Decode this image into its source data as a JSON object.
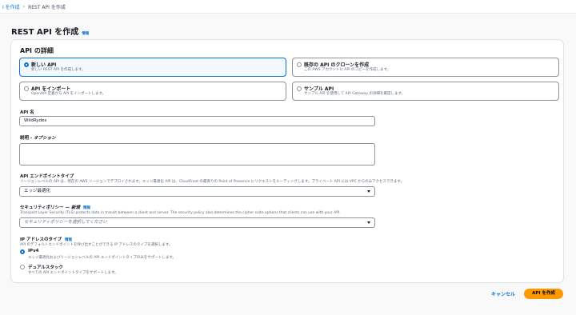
{
  "breadcrumb": {
    "parent": "I を作成",
    "separator": "›",
    "current": "REST API を作成"
  },
  "page": {
    "title": "REST API を作成",
    "info": "情報"
  },
  "details": {
    "title": "API の詳細",
    "options": [
      {
        "title": "新しい API",
        "desc": "新しい REST API を作成します。",
        "selected": true
      },
      {
        "title": "既存の API のクローンを作成",
        "desc": "この AWS アカウントに API のコピーを作成します。",
        "selected": false
      },
      {
        "title": "API をインポート",
        "desc": "OpenAPI 定義から API をインポートします。",
        "selected": false
      },
      {
        "title": "サンプル API",
        "desc": "サンプル API を使用して API Gateway の詳細を確認します。",
        "selected": false
      }
    ]
  },
  "api_name": {
    "label": "API 名",
    "value": "WildRydes"
  },
  "description": {
    "label": "説明 - ",
    "label_optional": "オプション",
    "value": ""
  },
  "endpoint": {
    "label": "API エンドポイントタイプ",
    "desc": "リージョンレベルの API は、現在の AWS リージョンでデプロイされます。エッジ最適化 API は、CloudFront の最寄りの Point of Presence にリクエストをルーティングします。プライベート API には VPC からのみアクセスできます。",
    "value": "エッジ最適化"
  },
  "security": {
    "label": "セキュリティポリシー — ",
    "label_new": "新規",
    "info": "情報",
    "desc": "Transport Layer Security (TLS) protects data in transit between a client and server. The security policy also determines the cipher suite options that clients can use with your API.",
    "placeholder": "セキュリティポリシーを選択してください"
  },
  "ip_type": {
    "label": "IP アドレスのタイプ",
    "info": "情報",
    "desc": "API のデフォルトエンドポイントを呼び出すことができる IP アドレスのタイプを選択します。",
    "options": [
      {
        "title": "IPv4",
        "desc": "エッジ最適化およびリージョンレベルの API エンドポイントタイプのみをサポートします。",
        "selected": true
      },
      {
        "title": "デュアルスタック",
        "desc": "すべての API エンドポイントタイプをサポートします。",
        "selected": false
      }
    ]
  },
  "actions": {
    "cancel": "キャンセル",
    "create": "API を作成"
  },
  "colors": {
    "accent": "#0972d3",
    "primary_button": "#ff9900"
  }
}
